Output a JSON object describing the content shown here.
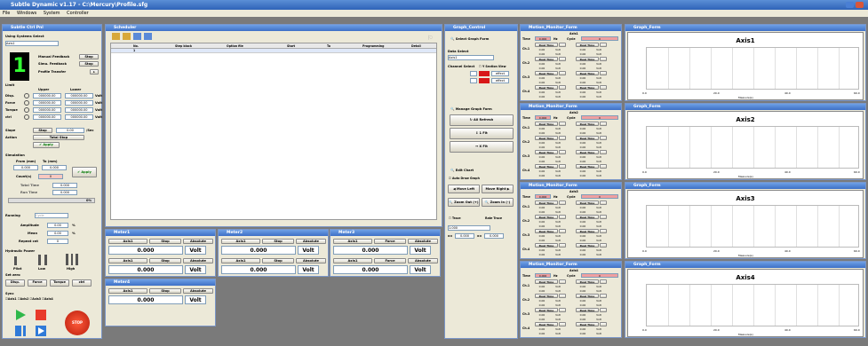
{
  "app": {
    "title": "Subtle Dynamic v1.17",
    "path": "C:\\Mercury\\Profile.sfg"
  },
  "menu": [
    "File",
    "Windows",
    "System",
    "Controller"
  ],
  "left": {
    "title": "Subtle Ctrl Pnl",
    "dsel_label": "Using Systems Select",
    "dsel_val": "Axis1",
    "channel_num": "1",
    "manual_fb": "Manual Feedback",
    "manual_btn": "Stop",
    "simu_fb": "Simu. Feedback",
    "simu_btn": "Stop",
    "profile": "Profile Transfer",
    "limit": "Limit",
    "upper": "Upper",
    "lower": "Lower",
    "limits": [
      {
        "name": "Disp.",
        "u": "000000.00",
        "l": "000000.00",
        "unit": "Volt"
      },
      {
        "name": "Force",
        "u": "000000.00",
        "l": "000000.00",
        "unit": "Volt"
      },
      {
        "name": "Torque",
        "u": "000000.00",
        "l": "000000.00",
        "unit": "Volt"
      },
      {
        "name": "ctrl",
        "u": "000000.00",
        "l": "000000.00",
        "unit": "Volt"
      }
    ],
    "slope": "Slope",
    "slope_val": "Stop",
    "slope_num": "0.00",
    "slope_unit": "/Sec",
    "action": "Action",
    "action_val": "Total Stop",
    "apply": "Apply",
    "simulation": "Simulation",
    "from": "From (mm)",
    "to": "To (mm)",
    "from_v": "0.000",
    "to_v": "0.000",
    "apply2": "Apply",
    "count": "Count(s)",
    "count_v": "0",
    "total_time": "Total Time",
    "total_v": "0.000",
    "run_time": "Run Time",
    "run_v": "0.000",
    "pct": "0%",
    "running": "Running",
    "running_v": "Cycle",
    "amplitude": "Amplitude",
    "amp_v": "0.00",
    "mean": "Mean",
    "mean_v": "0.00",
    "repeat": "Repeat cnt",
    "repeat_v": "0",
    "hyd": "Hydraulic Power",
    "pilot": "Pilot",
    "low": "Low",
    "high": "High",
    "set_zero": "Set zero",
    "zero_btns": [
      "Disp.",
      "Force",
      "Torque",
      "ctrl"
    ],
    "sync": "Sync",
    "sync_opts": [
      "Axis1",
      "Axis2",
      "Axis3",
      "Axis4"
    ],
    "stop_btn": "STOP"
  },
  "sched": {
    "title": "Scheduler",
    "cols": [
      "No.",
      "Step block",
      "Option file",
      "Start",
      "To",
      "Programming",
      "Detail"
    ],
    "row1": "1"
  },
  "meters": [
    {
      "title": "Meter1",
      "axis": "Axis1",
      "stop": "Stop",
      "abs": "Absolute",
      "val": "0.000",
      "unit": "Volt"
    },
    {
      "title": "Meter2",
      "axis": "Axis1",
      "stop": "Stop",
      "abs": "Absolute",
      "val": "0.000",
      "unit": "Volt"
    },
    {
      "title": "Meter3",
      "axis": "Axis1",
      "stop": "Force",
      "abs": "Absolute",
      "val": "0.000",
      "unit": "Volt"
    },
    {
      "title": "Meter4",
      "axis": "Axis1",
      "stop": "Stop",
      "abs": "Absolute",
      "val": "0.000",
      "unit": "Volt"
    }
  ],
  "gctrl": {
    "title": "Graph_Control",
    "select": "Select Graph Form",
    "data_select": "Data Select",
    "axis": "Axis1",
    "chan_sel": "Channel Select",
    "sec_view": "Y Section View",
    "ch": [
      "ch1",
      "ch2"
    ],
    "col": [
      "effect",
      "effect"
    ],
    "manage": "Manage Graph Form",
    "all": "All Refresh",
    "b1": "1 Fit",
    "b2": "X Fit",
    "edit": "Edit Chart",
    "auto": "Auto Draw Graph",
    "move_l": "Move Left",
    "move_r": "Move Right",
    "zoom_o": "Zoom Out (+)",
    "zoom_i": "Zoom In (-)",
    "trace": "Trace",
    "rate": "Rate Trace",
    "trace_sel": "1.000",
    "x_min": "0.000",
    "x_max": "0.000"
  },
  "monitors": [
    {
      "title": "Motion_Monitor_Form",
      "axis": "Axis1"
    },
    {
      "title": "Motion_Monitor_Form",
      "axis": "Axis2"
    },
    {
      "title": "Motion_Monitor_Form",
      "axis": "Axis3"
    },
    {
      "title": "Motion_Monitor_Form",
      "axis": "Axis4"
    }
  ],
  "mon": {
    "time": "Time",
    "time_v": "0.000",
    "hz": "Hz",
    "cycle": "Cycle",
    "cycle_v": "0",
    "chs": [
      "Ch.1",
      "Ch.2",
      "Ch.3",
      "Ch.4"
    ],
    "real": "Real Time",
    "r0": "0.00",
    "volt": "Volt"
  },
  "graphs": [
    {
      "title": "Graph_Form",
      "axis": "Axis1"
    },
    {
      "title": "Graph_Form",
      "axis": "Axis2"
    },
    {
      "title": "Graph_Form",
      "axis": "Axis3"
    },
    {
      "title": "Graph_Form",
      "axis": "Axis4"
    }
  ],
  "gaxis": {
    "ticks": [
      "0.0",
      "20.0",
      "40.0",
      "60.0"
    ],
    "xlabel": "Measure(s)"
  },
  "colors": {
    "accent": "#3d6fc6",
    "record": "#e83a2a",
    "play": "#2fb84a"
  }
}
